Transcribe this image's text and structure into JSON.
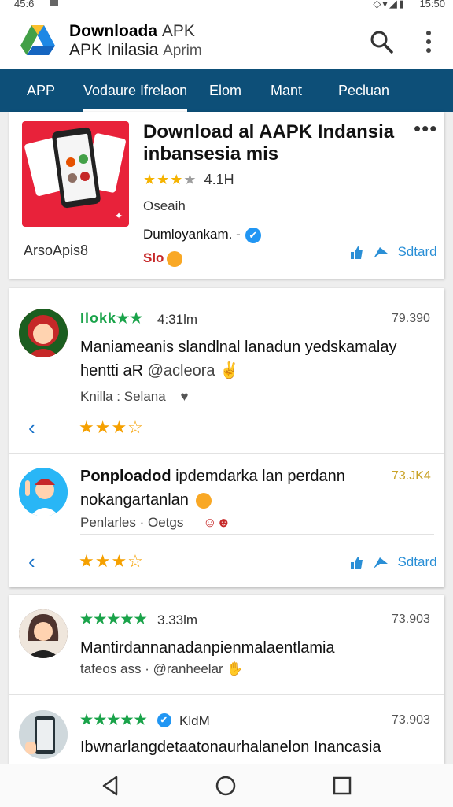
{
  "status": {
    "time_left": "45:6",
    "time_right": "15:50",
    "icons": "◇▾◢▮"
  },
  "appbar": {
    "title_bold": "Downloada",
    "title_light": "APK",
    "subtitle_main": "APK Inilasia",
    "subtitle_light": "Aprim",
    "icons": [
      "search-icon",
      "more-vert-icon"
    ]
  },
  "tabs": [
    {
      "label": "APP"
    },
    {
      "label": "Vodaure Ifrelaon"
    },
    {
      "label": "Elom"
    },
    {
      "label": "Mant"
    },
    {
      "label": "Pecluan"
    }
  ],
  "hero": {
    "title": "Download al AAPK Indansia inbansesia mis",
    "more": "•••",
    "stars_on": "★★★",
    "stars_off": "★",
    "rating_value": "4.1H",
    "subtitle": "Oseaih",
    "developer": "Dumloyankam. -",
    "verified_mark": "✔",
    "left_label": "ArsoApis8",
    "badge": "Slo",
    "action_label": "Sdtard"
  },
  "reviews": [
    {
      "stars": "★★★★★",
      "stars_text": "Ilokk★★",
      "time": "4:31lm",
      "count": "79.390",
      "text": "Maniameanis slandlnal lanadun yedskamalay hentti aR",
      "tag": "@acleora",
      "meta": "Knilla : Selana",
      "rate_on": "★★★",
      "rate_off": "☆"
    },
    {
      "stars": "",
      "time": "",
      "count": "73.JK4",
      "text_bold": "Ponploadod",
      "text": "ipdemdarka lan perdann nokangartanlan",
      "meta": "Penlarles · Oetgs",
      "rate_on": "★★★",
      "rate_off": "☆",
      "action_label": "Sdtard"
    },
    {
      "stars": "★★★★★",
      "time": "3.33lm",
      "count": "73.903",
      "text": "Mantirdannanadanpienmalaentlamia",
      "meta": "tafeos ass · @ranheelar"
    },
    {
      "stars": "★★★★★",
      "time": "KldM",
      "count": "73.903",
      "text": "Ibwnarlangdetaatonaurhalanelon Inancasia"
    }
  ],
  "navbar": {
    "buttons": [
      "back-icon",
      "home-icon",
      "recents-icon"
    ]
  },
  "colors": {
    "tabbar": "#0d4f78",
    "accent": "#2a8fd6",
    "star_green": "#1aa34a",
    "star_gold": "#f5a000",
    "hero_bg": "#e8223a"
  }
}
